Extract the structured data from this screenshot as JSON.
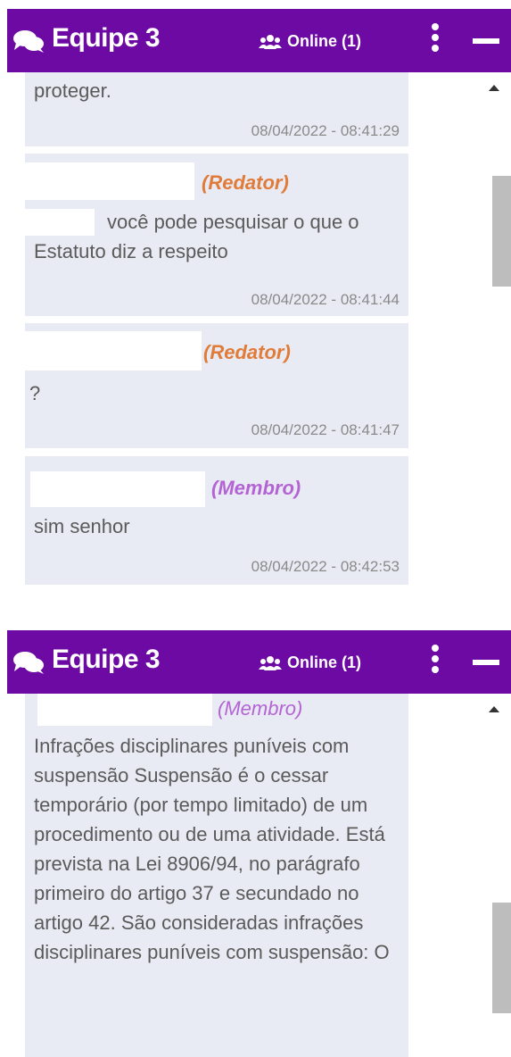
{
  "panel1": {
    "header": {
      "title": "Equipe 3",
      "online": "Online (1)"
    },
    "messages": [
      {
        "text": "proteger.",
        "time": "08/04/2022 - 08:41:29"
      },
      {
        "role": "(Redator)",
        "text": "você pode pesquisar o que o Estatuto diz a respeito",
        "time": "08/04/2022 - 08:41:44"
      },
      {
        "role": "(Redator)",
        "text": "?",
        "time": "08/04/2022 - 08:41:47"
      },
      {
        "role": "(Membro)",
        "text": "sim senhor",
        "time": "08/04/2022 - 08:42:53"
      }
    ]
  },
  "panel2": {
    "header": {
      "title": "Equipe 3",
      "online": "Online (1)"
    },
    "messages": [
      {
        "role": "(Membro)",
        "text": "Infrações disciplinares puníveis com suspensão Suspensão é o cessar temporário (por tempo limitado) de um procedimento ou de uma atividade. Está prevista na Lei 8906/94, no parágrafo primeiro do artigo 37 e secundado no artigo 42. São consideradas infrações disciplinares puníveis com suspensão: O"
      }
    ]
  },
  "colors": {
    "header": "#6d0aa3",
    "bubble": "#e9ebf4",
    "redator": "#e07b39",
    "membro": "#b463d4"
  },
  "icons": {
    "chat": "chat-bubbles-icon",
    "online": "users-icon",
    "menu": "kebab-menu-icon",
    "minimize": "minimize-icon"
  }
}
